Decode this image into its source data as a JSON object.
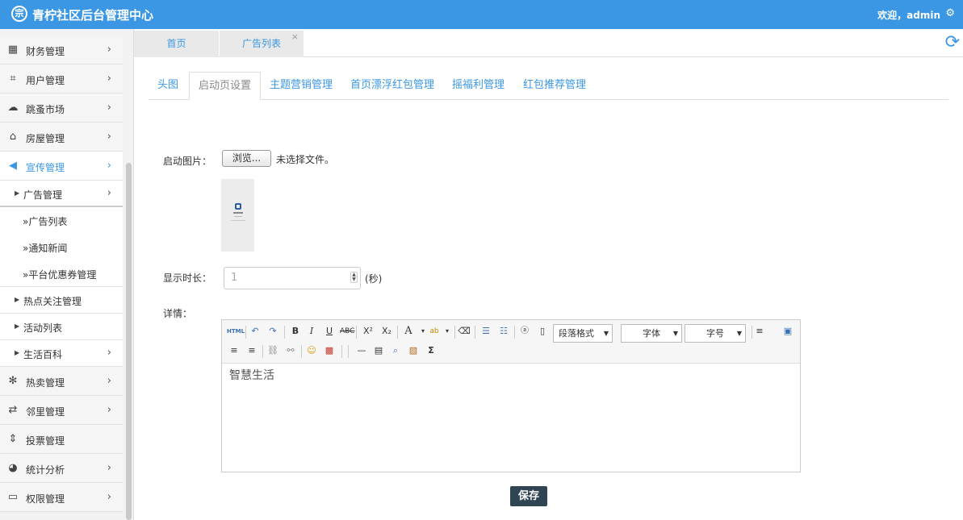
{
  "header": {
    "logo_glyph": "宗",
    "title": "青柠社区后台管理中心",
    "welcome": "欢迎，admin",
    "gear": "⚙"
  },
  "sidebar": {
    "items": [
      {
        "label": "财务管理",
        "icon": "calculator-icon",
        "glyph": "▦"
      },
      {
        "label": "用户管理",
        "icon": "crop-icon",
        "glyph": "⌗"
      },
      {
        "label": "跳蚤市场",
        "icon": "cloud-icon",
        "glyph": "☁"
      },
      {
        "label": "房屋管理",
        "icon": "bank-icon",
        "glyph": "⌂"
      },
      {
        "label": "宣传管理",
        "icon": "megaphone-icon",
        "glyph": "◀"
      }
    ],
    "submenu": {
      "ad_manage": "广告管理",
      "ad_list": "»广告列表",
      "notice_news": "»通知新闻",
      "coupon_manage": "»平台优惠券管理",
      "hot_focus": "热点关注管理",
      "activity_list": "活动列表",
      "life_wiki": "生活百科"
    },
    "items_after": [
      {
        "label": "热卖管理",
        "icon": "gear-outline-icon",
        "glyph": "✻"
      },
      {
        "label": "邻里管理",
        "icon": "retweet-icon",
        "glyph": "⇄"
      },
      {
        "label": "投票管理",
        "icon": "sort-icon",
        "glyph": "⇕"
      },
      {
        "label": "统计分析",
        "icon": "pie-chart-icon",
        "glyph": "◕"
      },
      {
        "label": "权限管理",
        "icon": "monitor-icon",
        "glyph": "▭"
      }
    ],
    "chevron": "›"
  },
  "page_tabs": {
    "home": "首页",
    "ad_list": "广告列表",
    "close": "×",
    "refresh": "⟳"
  },
  "sub_tabs": [
    "头图",
    "启动页设置",
    "主题营销管理",
    "首页漂浮红包管理",
    "摇福利管理",
    "红包推荐管理"
  ],
  "form": {
    "launch_image_label": "启动图片：",
    "browse_label": "浏览...",
    "no_file": "未选择文件。",
    "duration_label": "显示时长：",
    "duration_value": "1",
    "duration_unit": "(秒)",
    "detail_label": "详情："
  },
  "editor": {
    "paragraph_format": "段落格式",
    "font_family": "字体",
    "font_size": "字号",
    "content": "智慧生活"
  },
  "save_label": "保存"
}
